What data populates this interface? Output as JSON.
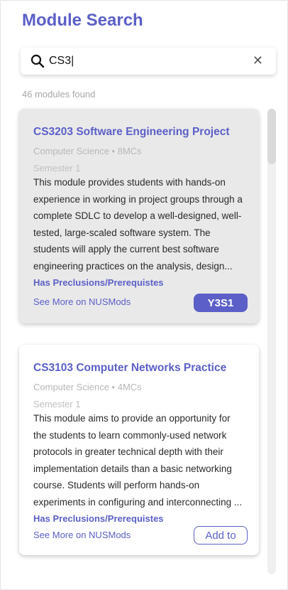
{
  "page": {
    "title": "Module Search"
  },
  "search": {
    "value": "CS3|",
    "placeholder": ""
  },
  "results": {
    "count_text": "46 modules found"
  },
  "modules": [
    {
      "code_title": "CS3203 Software Engineering Project",
      "meta": "Computer Science • 8MCs",
      "semester": "Semester 1",
      "description": "This module provides students with hands-on experience in working in project groups through a complete SDLC to develop a well-designed, well-tested, large-scaled software system. The students will apply the current best software engineering practices on the analysis, design...",
      "prereq_label": "Has Preclusions/Prerequistes",
      "more_label": "See More on NUSMods",
      "action_label": "Y3S1"
    },
    {
      "code_title": "CS3103 Computer Networks Practice",
      "meta": "Computer Science • 4MCs",
      "semester": "Semester 1",
      "description": "This module aims to provide an opportunity for the students to learn commonly-used network protocols in greater technical depth with their implementation details than a basic networking course. Students will perform hands-on experiments in configuring and interconnecting ...",
      "prereq_label": "Has Preclusions/Prerequistes",
      "more_label": "See More on NUSMods",
      "action_label": "Add to"
    }
  ],
  "colors": {
    "accent": "#5b5fc7",
    "muted": "#a7a7a7",
    "active_card": "#e9e9e9"
  },
  "icons": {
    "search": "search-icon",
    "clear": "close-icon"
  }
}
